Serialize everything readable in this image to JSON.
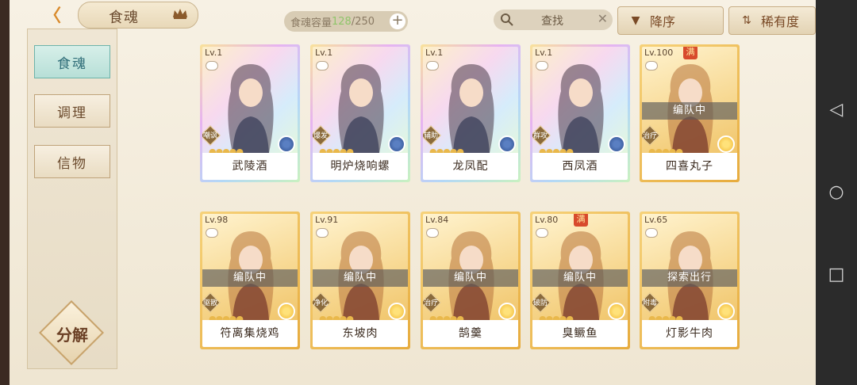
{
  "header": {
    "back_label": "〈",
    "title": "食魂",
    "capacity_label": "食魂容量",
    "capacity_current": "128",
    "capacity_max": "/250",
    "add_label": "+",
    "search_text": "查找",
    "clear_label": "✕",
    "sort_desc_label": "降序",
    "sort_rarity_label": "稀有度"
  },
  "sidebar": {
    "tabs": [
      {
        "label": "食魂",
        "active": true
      },
      {
        "label": "调理",
        "active": false
      },
      {
        "label": "信物",
        "active": false
      }
    ],
    "decompose_label": "分解"
  },
  "cards": [
    {
      "level": "Lv.1",
      "name": "武陵酒",
      "role": "嘲讽",
      "status": "",
      "frame": "rainbow",
      "element": "blue",
      "full": false
    },
    {
      "level": "Lv.1",
      "name": "明炉烧响螺",
      "role": "爆发",
      "status": "",
      "frame": "rainbow",
      "element": "blue",
      "full": false
    },
    {
      "level": "Lv.1",
      "name": "龙凤配",
      "role": "辅助",
      "status": "",
      "frame": "rainbow",
      "element": "blue",
      "full": false
    },
    {
      "level": "Lv.1",
      "name": "西凤酒",
      "role": "群攻",
      "status": "",
      "frame": "rainbow",
      "element": "blue",
      "full": false
    },
    {
      "level": "Lv.100",
      "name": "四喜丸子",
      "role": "治疗",
      "status": "编队中",
      "frame": "gold",
      "element": "yellow",
      "full": true
    },
    {
      "level": "Lv.98",
      "name": "符离集烧鸡",
      "role": "驱散",
      "status": "编队中",
      "frame": "gold",
      "element": "yellow",
      "full": false
    },
    {
      "level": "Lv.91",
      "name": "东坡肉",
      "role": "净化",
      "status": "编队中",
      "frame": "gold",
      "element": "yellow",
      "full": false
    },
    {
      "level": "Lv.84",
      "name": "鹄羹",
      "role": "治疗",
      "status": "编队中",
      "frame": "gold",
      "element": "yellow",
      "full": false
    },
    {
      "level": "Lv.80",
      "name": "臭鳜鱼",
      "role": "破防",
      "status": "编队中",
      "frame": "gold",
      "element": "yellow",
      "full": true
    },
    {
      "level": "Lv.65",
      "name": "灯影牛肉",
      "role": "附毒",
      "status": "探索出行",
      "frame": "gold",
      "element": "yellow",
      "full": false
    }
  ],
  "full_badge_label": "满",
  "navbar": {
    "back_icon": "◁",
    "home_icon": "○",
    "recent_icon": "□"
  }
}
